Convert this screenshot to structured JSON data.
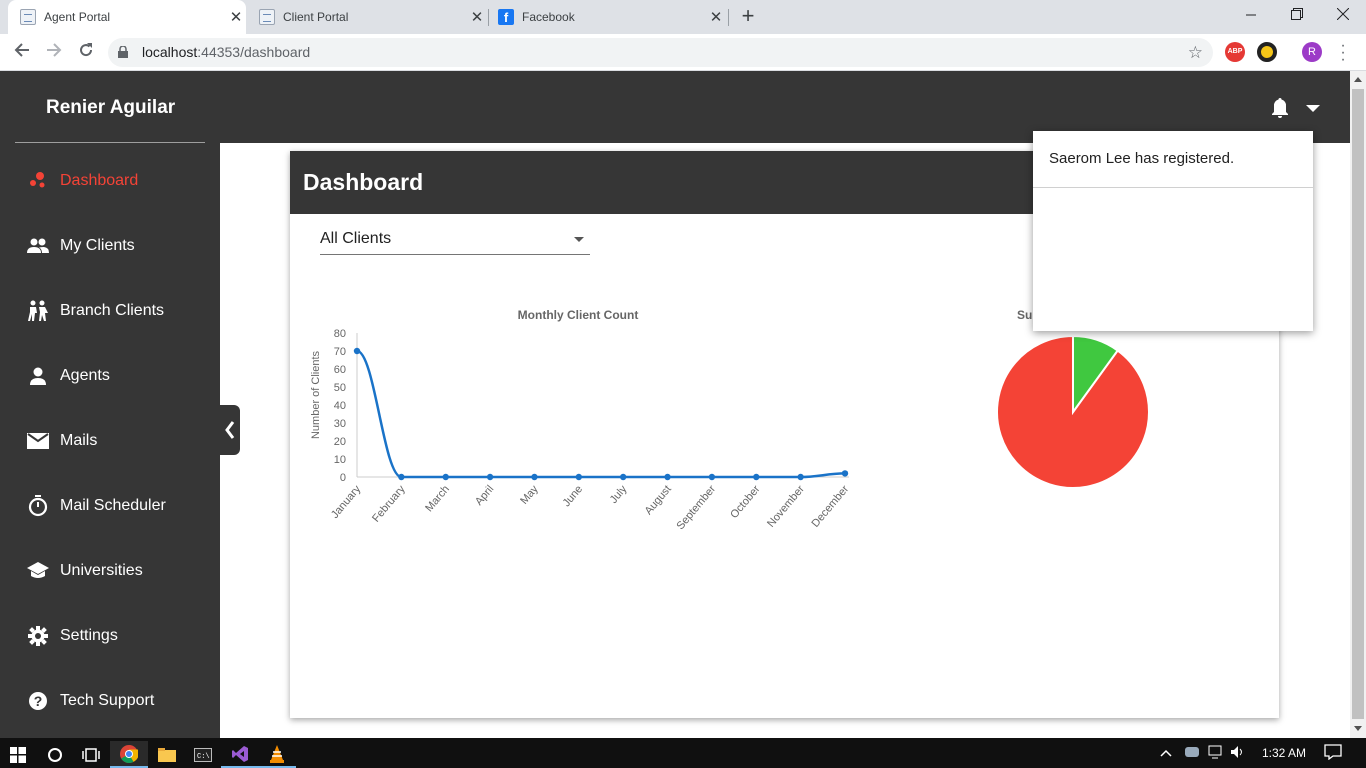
{
  "browser": {
    "tabs": [
      {
        "title": "Agent Portal",
        "favicon": "document-icon",
        "active": true
      },
      {
        "title": "Client Portal",
        "favicon": "document-icon",
        "active": false
      },
      {
        "title": "Facebook",
        "favicon": "facebook-icon",
        "active": false
      }
    ],
    "tab_close": "✕",
    "new_tab": "+",
    "url_host": "localhost",
    "url_rest": ":44353/dashboard",
    "profile_initial": "R",
    "abp_label": "ABP"
  },
  "app": {
    "user_name": "Renier Aguilar",
    "accent": "#f44336",
    "dark": "#363636",
    "nav": [
      {
        "label": "Dashboard",
        "icon": "dashboard-icon",
        "active": true
      },
      {
        "label": "My Clients",
        "icon": "people-icon"
      },
      {
        "label": "Branch Clients",
        "icon": "group-icon"
      },
      {
        "label": "Agents",
        "icon": "person-icon"
      },
      {
        "label": "Mails",
        "icon": "mail-icon"
      },
      {
        "label": "Mail Scheduler",
        "icon": "timer-icon"
      },
      {
        "label": "Universities",
        "icon": "school-icon"
      },
      {
        "label": "Settings",
        "icon": "gear-icon"
      },
      {
        "label": "Tech Support",
        "icon": "help-icon"
      }
    ],
    "dashboard_title": "Dashboard",
    "filter_value": "All Clients",
    "notification": "Saerom Lee has registered.",
    "pie_title_partial": "Su"
  },
  "chart_data": [
    {
      "type": "line",
      "title": "Monthly Client Count",
      "xlabel": "",
      "ylabel": "Number of Clients",
      "ylim": [
        0,
        80
      ],
      "yticks": [
        0,
        10,
        20,
        30,
        40,
        50,
        60,
        70,
        80
      ],
      "categories": [
        "January",
        "February",
        "March",
        "April",
        "May",
        "June",
        "July",
        "August",
        "September",
        "October",
        "November",
        "December"
      ],
      "values": [
        70,
        0,
        0,
        0,
        0,
        0,
        0,
        0,
        0,
        0,
        0,
        2
      ],
      "color": "#1a73c8"
    },
    {
      "type": "pie",
      "title": "Su",
      "values": [
        90,
        10
      ],
      "colors": [
        "#f44336",
        "#40c840"
      ]
    }
  ],
  "taskbar": {
    "time": "1:32 AM"
  }
}
